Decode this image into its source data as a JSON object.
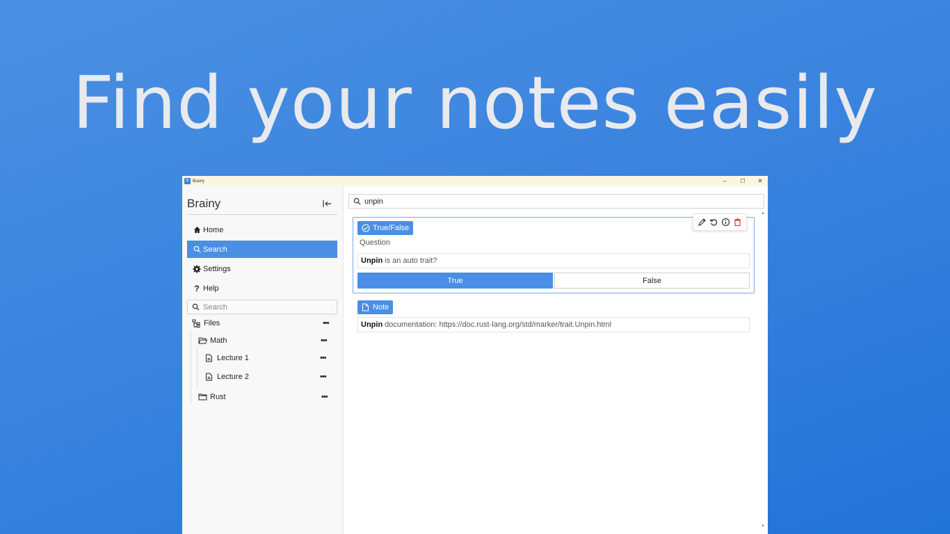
{
  "hero": {
    "headline": "Find your notes easily"
  },
  "window": {
    "title": "Brainy",
    "controls": {
      "minimize": "–",
      "maximize": "☐",
      "close": "✕"
    }
  },
  "sidebar": {
    "brand": "Brainy",
    "nav": [
      {
        "label": "Home",
        "icon": "home-icon"
      },
      {
        "label": "Search",
        "icon": "search-icon",
        "active": true
      },
      {
        "label": "Settings",
        "icon": "gear-icon"
      },
      {
        "label": "Help",
        "icon": "question-icon"
      }
    ],
    "search_placeholder": "Search",
    "tree": {
      "root": "Files",
      "folders": [
        {
          "name": "Math",
          "files": [
            "Lecture 1",
            "Lecture 2"
          ]
        },
        {
          "name": "Rust",
          "files": []
        }
      ],
      "more_label": "•••"
    }
  },
  "main": {
    "search_value": "unpin",
    "results": [
      {
        "type_label": "True/False",
        "field_label": "Question",
        "keyword": "Unpin",
        "text": "is an auto trait?",
        "answers": [
          "True",
          "False"
        ]
      },
      {
        "type_label": "Note",
        "keyword": "Unpin",
        "text": "documentation: https://doc.rust-lang.org/std/marker/trait.Unpin.html"
      }
    ]
  },
  "colors": {
    "accent": "#4a8fe3",
    "delete": "#e03b3b",
    "background": "#3b84df"
  }
}
